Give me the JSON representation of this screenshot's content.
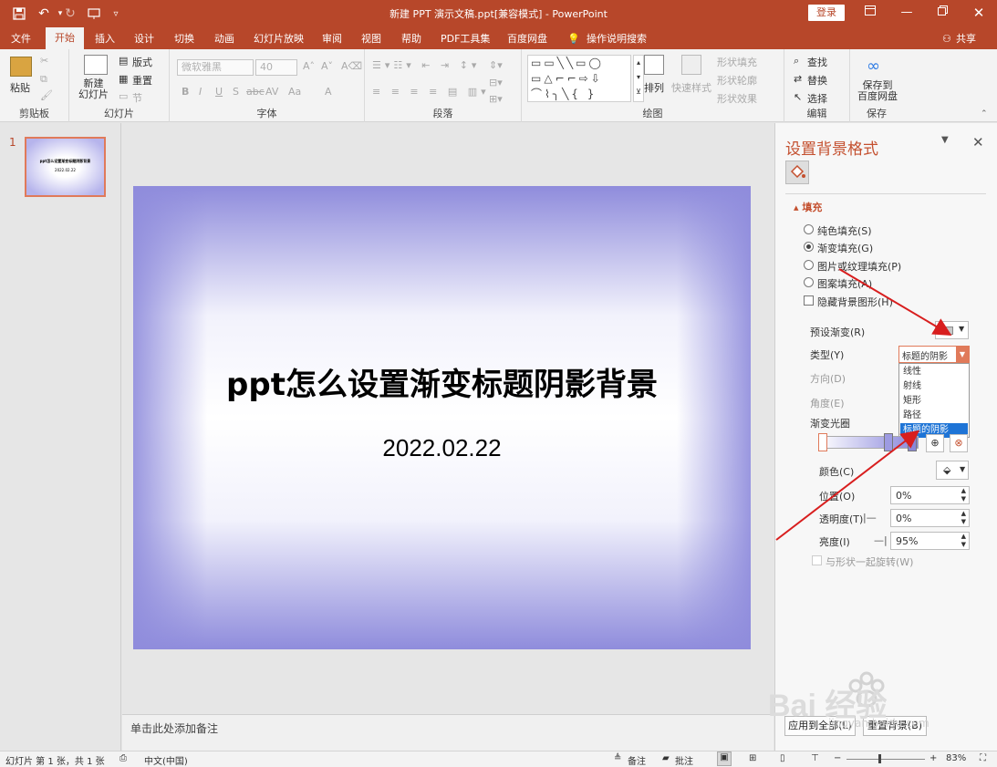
{
  "window": {
    "title": "新建 PPT 演示文稿.ppt[兼容模式]  -  PowerPoint",
    "login_label": "登录",
    "share_label": "共享"
  },
  "quick_access": {
    "icons": [
      "save-icon",
      "undo-icon",
      "redo-icon",
      "present-icon",
      "customize-icon"
    ]
  },
  "tabs": [
    "文件",
    "开始",
    "插入",
    "设计",
    "切换",
    "动画",
    "幻灯片放映",
    "审阅",
    "视图",
    "帮助",
    "PDF工具集",
    "百度网盘"
  ],
  "active_tab": "开始",
  "tell_me": "操作说明搜索",
  "ribbon": {
    "clipboard": {
      "label": "剪贴板",
      "paste": "粘贴"
    },
    "slides": {
      "label": "幻灯片",
      "new_slide": "新建\n幻灯片",
      "layout": "版式",
      "reset": "重置",
      "section": "节"
    },
    "font": {
      "label": "字体",
      "font_name": "微软雅黑",
      "font_size": "40",
      "buttons": [
        "B",
        "I",
        "U",
        "S",
        "abc",
        "AV",
        "Aa",
        "A"
      ]
    },
    "paragraph": {
      "label": "段落"
    },
    "drawing": {
      "label": "绘图",
      "arrange": "排列",
      "quick_styles": "快速样式",
      "shape_fill": "形状填充",
      "shape_outline": "形状轮廓",
      "shape_effects": "形状效果"
    },
    "editing": {
      "label": "编辑",
      "find": "查找",
      "replace": "替换",
      "select": "选择"
    },
    "save": {
      "label": "保存",
      "save_baidu": "保存到\n百度网盘"
    }
  },
  "thumbnails": [
    {
      "number": "1",
      "title": "ppt怎么设置渐变标题阴影背景",
      "date": "2022.02.22"
    }
  ],
  "slide": {
    "title": "ppt怎么设置渐变标题阴影背景",
    "date": "2022.02.22"
  },
  "notes_placeholder": "单击此处添加备注",
  "format_pane": {
    "title": "设置背景格式",
    "section": "填充",
    "options": [
      {
        "label": "纯色填充(S)",
        "selected": false
      },
      {
        "label": "渐变填充(G)",
        "selected": true
      },
      {
        "label": "图片或纹理填充(P)",
        "selected": false
      },
      {
        "label": "图案填充(A)",
        "selected": false
      }
    ],
    "hide_bg_graphics": "隐藏背景图形(H)",
    "preset_gradient": "预设渐变(R)",
    "type_label": "类型(Y)",
    "type_value": "标题的阴影",
    "direction_label": "方向(D)",
    "angle_label": "角度(E)",
    "gradient_stops": "渐变光圈",
    "color_label": "颜色(C)",
    "position_label": "位置(O)",
    "position_value": "0%",
    "transparency_label": "透明度(T)",
    "transparency_value": "0%",
    "brightness_label": "亮度(I)",
    "brightness_value": "95%",
    "rotate_with_shape": "与形状一起旋转(W)",
    "type_options": [
      "线性",
      "射线",
      "矩形",
      "路径",
      "标题的阴影"
    ],
    "type_selected": "标题的阴影",
    "apply_all": "应用到全部(L)",
    "reset_bg": "重置背景(B)"
  },
  "statusbar": {
    "slide_info": "幻灯片 第 1 张，共 1 张",
    "language": "中文(中国)",
    "notes": "备注",
    "comments": "批注",
    "zoom": "83%"
  },
  "watermark": {
    "text": "Bai 经验",
    "subtext": "jingyan.baidu.com"
  },
  "colors": {
    "accent": "#b7472a",
    "pane_title": "#c4502f",
    "annotation_arrow": "#d81e1e",
    "slide_gradient": "#8f8cdc"
  }
}
